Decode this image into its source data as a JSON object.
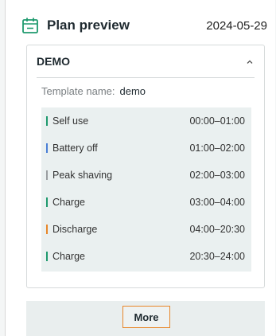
{
  "header": {
    "icon": "calendar-icon",
    "title": "Plan preview",
    "date": "2024-05-29",
    "accent_color": "#1e9a6e"
  },
  "card": {
    "title": "DEMO",
    "collapse_icon": "chevron-up-icon",
    "template_label": "Template name:",
    "template_value": "demo",
    "schedule": [
      {
        "mode": "Self use",
        "time": "00:00–01:00",
        "color": "#1e9a6e"
      },
      {
        "mode": "Battery off",
        "time": "01:00–02:00",
        "color": "#4a7fd6"
      },
      {
        "mode": "Peak shaving",
        "time": "02:00–03:00",
        "color": "#9a9ea1"
      },
      {
        "mode": "Charge",
        "time": "03:00–04:00",
        "color": "#1e9a6e"
      },
      {
        "mode": "Discharge",
        "time": "04:00–20:30",
        "color": "#e8872a"
      },
      {
        "mode": "Charge",
        "time": "20:30–24:00",
        "color": "#1e9a6e"
      }
    ]
  },
  "footer": {
    "more_label": "More",
    "button_border_color": "#e8872a"
  }
}
